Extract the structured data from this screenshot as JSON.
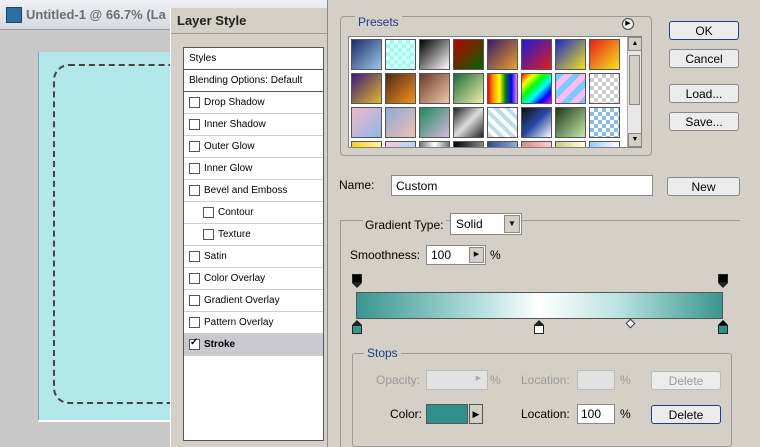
{
  "document": {
    "title": "Untitled-1 @ 66.7% (La"
  },
  "dialog": {
    "title": "Layer Style",
    "styles_header": "Styles",
    "blending_options": "Blending Options: Default",
    "effects": [
      {
        "label": "Drop Shadow",
        "checked": false
      },
      {
        "label": "Inner Shadow",
        "checked": false
      },
      {
        "label": "Outer Glow",
        "checked": false
      },
      {
        "label": "Inner Glow",
        "checked": false
      },
      {
        "label": "Bevel and Emboss",
        "checked": false
      },
      {
        "label": "Contour",
        "checked": false
      },
      {
        "label": "Texture",
        "checked": false
      },
      {
        "label": "Satin",
        "checked": false
      },
      {
        "label": "Color Overlay",
        "checked": false
      },
      {
        "label": "Gradient Overlay",
        "checked": false
      },
      {
        "label": "Pattern Overlay",
        "checked": false
      },
      {
        "label": "Stroke",
        "checked": true
      }
    ]
  },
  "gradient_editor": {
    "presets_label": "Presets",
    "buttons": {
      "ok": "OK",
      "cancel": "Cancel",
      "load": "Load...",
      "save": "Save...",
      "new": "New"
    },
    "name_label": "Name:",
    "name_value": "Custom",
    "gradient_type_label": "Gradient Type:",
    "gradient_type_value": "Solid",
    "smoothness_label": "Smoothness:",
    "smoothness_value": "100",
    "smoothness_unit": "%",
    "stops_label": "Stops",
    "opacity_label": "Opacity:",
    "opacity_unit": "%",
    "opacity_location_label": "Location:",
    "opacity_location_unit": "%",
    "delete_disabled": "Delete",
    "color_label": "Color:",
    "color_value": "#2f8f8a",
    "location_label": "Location:",
    "location_value": "100",
    "location_unit": "%",
    "delete": "Delete",
    "gradient_colors": [
      "#3a9590",
      "#b9e2df",
      "#ffffff",
      "#b9e2df",
      "#3a9590"
    ]
  },
  "preset_swatches": [
    "linear-gradient(135deg,#1a2d6b,#9fc6e8)",
    "repeating-conic-gradient(#9fe 0 25%,#dff 0 50%) 0 0/8px 8px",
    "linear-gradient(135deg,#000,#fff)",
    "linear-gradient(135deg,#b00,#060)",
    "linear-gradient(135deg,#3a1a6b,#e8a12a)",
    "linear-gradient(135deg,#1b1bd8,#e31b1b)",
    "linear-gradient(135deg,#1b28c8,#f0e61b)",
    "linear-gradient(135deg,#e81b1b,#f5e61b)",
    "linear-gradient(135deg,#3a1a7b,#e3b82a)",
    "linear-gradient(135deg,#4a2a18,#f7931e)",
    "linear-gradient(135deg,#6b3a2a,#f0c8a8)",
    "linear-gradient(135deg,#1b6b3a,#f0f0a8)",
    "linear-gradient(90deg,red,orange,yellow,green,blue,violet)",
    "linear-gradient(135deg,red,yellow,lime,cyan,blue,magenta)",
    "repeating-linear-gradient(135deg,#7cf 0 6px,#fbe 6px 12px)",
    "repeating-conic-gradient(#ccc 0 25%,#fff 0 50%) 0 0/8px 8px",
    "linear-gradient(135deg,#f0b8c8,#8fb8e8)",
    "linear-gradient(135deg,#8fa8d8,#f0c0b0)",
    "linear-gradient(135deg,#1b8a5a,#d8b8e0)",
    "linear-gradient(135deg,#222,#ddd,#222)",
    "repeating-linear-gradient(45deg,#bde 0 4px,#fff 4px 8px)",
    "linear-gradient(135deg,#111,#2a4aa8,#fff)",
    "linear-gradient(135deg,#1b3a1b,#c8e8a8)",
    "repeating-conic-gradient(#8be 0 25%,#fff 0 50%) 0 0/8px 8px",
    "linear-gradient(90deg,#f5d21b,#fff3a8)",
    "linear-gradient(90deg,#f0c8d8,#b8d8f0)",
    "linear-gradient(90deg,#777,#fff,#777)",
    "linear-gradient(90deg,#000,#888)",
    "linear-gradient(90deg,#2a4a9a,#9ac)",
    "linear-gradient(90deg,#d88,#fcc)",
    "linear-gradient(90deg,#cc8,#ffd)",
    "linear-gradient(90deg,#9cf,#fff)"
  ]
}
